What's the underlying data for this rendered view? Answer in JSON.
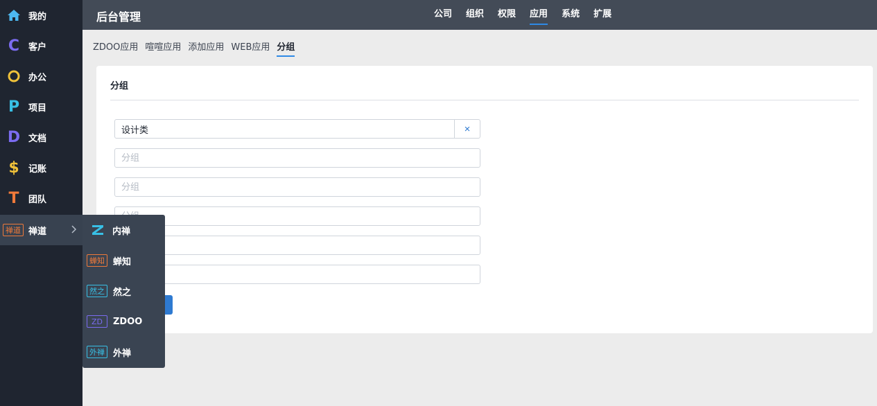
{
  "topbar": {
    "title": "后台管理",
    "nav": [
      {
        "label": "公司",
        "active": false
      },
      {
        "label": "组织",
        "active": false
      },
      {
        "label": "权限",
        "active": false
      },
      {
        "label": "应用",
        "active": true
      },
      {
        "label": "系统",
        "active": false
      },
      {
        "label": "扩展",
        "active": false
      }
    ]
  },
  "sidebar": {
    "items": [
      {
        "label": "我的",
        "icon": "home-icon",
        "color": "#4db8f0"
      },
      {
        "label": "客户",
        "icon": "c-letter-icon",
        "glyph": "C",
        "color": "#7b6cf0"
      },
      {
        "label": "办公",
        "icon": "o-circle-icon",
        "color": "#f0c23a"
      },
      {
        "label": "项目",
        "icon": "p-letter-icon",
        "glyph": "P",
        "color": "#38c0e6"
      },
      {
        "label": "文档",
        "icon": "d-letter-icon",
        "glyph": "D",
        "color": "#7b6cf0"
      },
      {
        "label": "记账",
        "icon": "dollar-icon",
        "glyph": "$",
        "color": "#f0c23a"
      },
      {
        "label": "团队",
        "icon": "t-letter-icon",
        "glyph": "T",
        "color": "#f07a3a"
      },
      {
        "label": "禅道",
        "icon": "chandao-badge-icon",
        "badge": "禅道",
        "color": "#f07a3a"
      }
    ]
  },
  "subtabs": [
    {
      "label": "ZDOO应用",
      "active": false
    },
    {
      "label": "喧喧应用",
      "active": false
    },
    {
      "label": "添加应用",
      "active": false
    },
    {
      "label": "WEB应用",
      "active": false
    },
    {
      "label": "分组",
      "active": true
    }
  ],
  "card": {
    "title": "分组",
    "fields": [
      {
        "value": "设计类",
        "placeholder": "分组"
      },
      {
        "value": "",
        "placeholder": "分组"
      },
      {
        "value": "",
        "placeholder": "分组"
      },
      {
        "value": "",
        "placeholder": "分组"
      },
      {
        "value": "",
        "placeholder": "分组"
      },
      {
        "value": "",
        "placeholder": "分组"
      }
    ],
    "clear_symbol": "×"
  },
  "popover": {
    "items": [
      {
        "label": "内禅",
        "icon": "z-logo-icon",
        "glyph": "Z",
        "color": "#38c0e6"
      },
      {
        "label": "蝉知",
        "icon": "chanzhi-badge-icon",
        "badge": "蝉知",
        "color": "#f07a3a"
      },
      {
        "label": "然之",
        "icon": "ranzhi-badge-icon",
        "badge": "然之",
        "color": "#38c0e6"
      },
      {
        "label": "ZDOO",
        "icon": "zdoo-badge-icon",
        "badge": "ZD",
        "color": "#7b6cf0"
      },
      {
        "label": "外禅",
        "icon": "waichan-badge-icon",
        "badge": "外禅",
        "color": "#38c0e6"
      }
    ]
  },
  "colors": {
    "sidebar_bg": "#1f2530",
    "topbar_bg": "#434b57",
    "accent": "#2e7ad1",
    "popover_bg": "#3a4452"
  }
}
